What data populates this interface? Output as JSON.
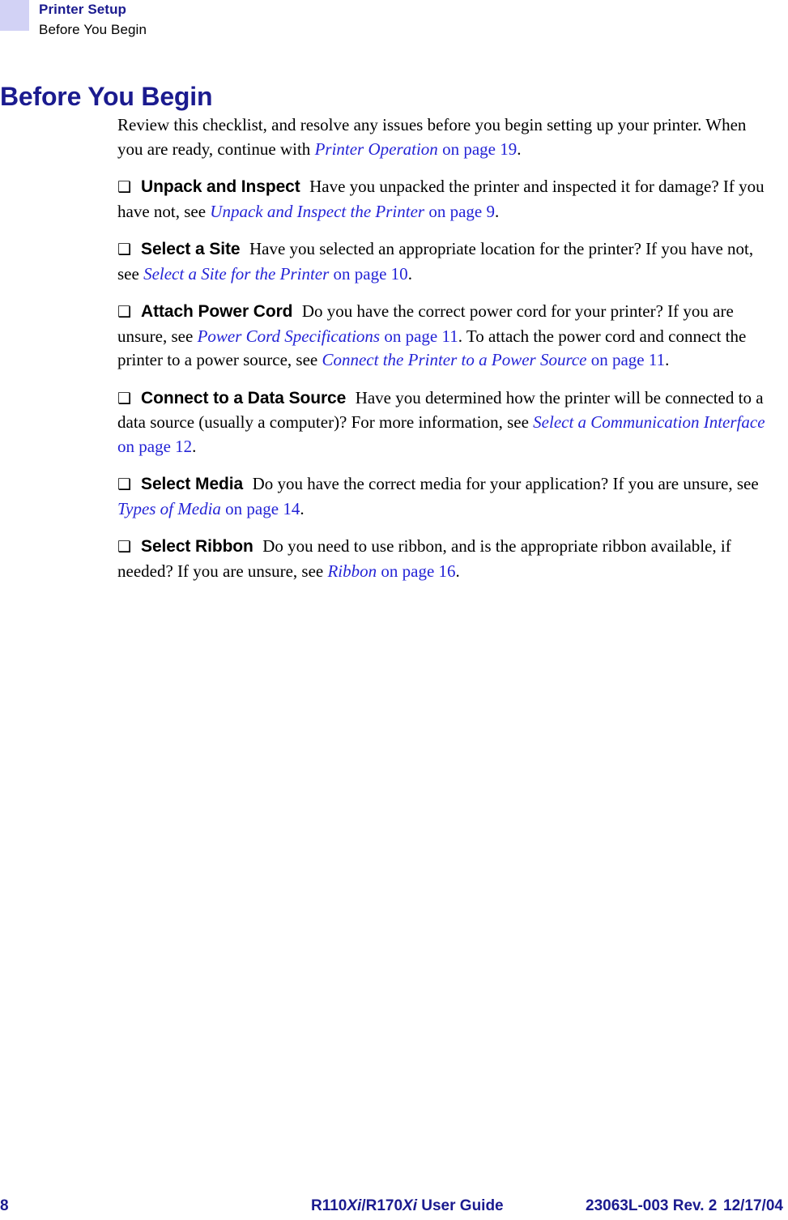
{
  "header": {
    "chapter": "Printer Setup",
    "section": "Before You Begin"
  },
  "title": "Before You Begin",
  "intro": {
    "text_before": "Review this checklist, and resolve any issues before you begin setting up your printer. When you are ready, continue with ",
    "xref": "Printer Operation",
    "xref_page": " on page 19",
    "text_after": "."
  },
  "checkbox_glyph": "❑",
  "items": [
    {
      "label": "Unpack and Inspect",
      "text_before": "Have you unpacked the printer and inspected it for damage? If you have not, see ",
      "xref": "Unpack and Inspect the Printer",
      "xref_page": " on page 9",
      "text_after": "."
    },
    {
      "label": "Select a Site",
      "text_before": "Have you selected an appropriate location for the printer? If you have not, see ",
      "xref": "Select a Site for the Printer",
      "xref_page": " on page 10",
      "text_after": "."
    },
    {
      "label": "Attach Power Cord",
      "text_before": "Do you have the correct power cord for your printer? If you are unsure, see ",
      "xref": "Power Cord Specifications",
      "xref_page": " on page 11",
      "text_mid": ". To attach the power cord and connect the printer to a power source, see ",
      "xref2": "Connect the Printer to a Power Source",
      "xref2_page": " on page 11",
      "text_after": "."
    },
    {
      "label": "Connect to a Data Source",
      "text_before": "Have you determined how the printer will be connected to a data source (usually a computer)? For more information, see ",
      "xref": "Select a Communication Interface",
      "xref_page": " on page 12",
      "text_after": "."
    },
    {
      "label": "Select Media",
      "text_before": "Do you have the correct media for your application? If you are unsure, see ",
      "xref": "Types of Media",
      "xref_page": " on page 14",
      "text_after": "."
    },
    {
      "label": "Select Ribbon",
      "text_before": "Do you need to use ribbon, and is the appropriate ribbon available, if needed? If you are unsure, see ",
      "xref": "Ribbon",
      "xref_page": " on page 16",
      "text_after": "."
    }
  ],
  "footer": {
    "page_number": "8",
    "guide_part1": "R110",
    "guide_model1": "Xi",
    "guide_part2": "/R170",
    "guide_model2": "Xi",
    "guide_part3": " User Guide",
    "doc_id": "23063L-003 Rev. 2",
    "date": "12/17/04"
  },
  "colors": {
    "heading_blue": "#1b1b8f",
    "link_blue": "#2424d6",
    "header_swatch": "#d2d2f5"
  }
}
